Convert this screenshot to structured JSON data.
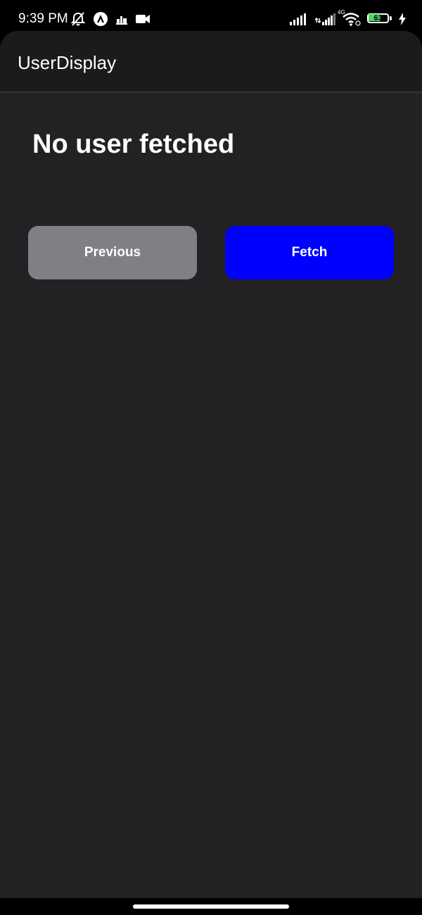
{
  "status_bar": {
    "time": "9:39 PM",
    "left_icons": [
      "bell-muted-icon",
      "app-logo-icon",
      "notification-icon",
      "video-camera-icon"
    ],
    "network_type": "4G",
    "battery_level": "63",
    "battery_fraction": 0.63,
    "battery_color": "#4cd964",
    "right_icons": [
      "cell-signal-icon",
      "cell-signal-4g-icon",
      "wifi-icon",
      "battery-icon",
      "charging-bolt-icon"
    ]
  },
  "app_bar": {
    "title": "UserDisplay"
  },
  "main": {
    "heading": "No user fetched",
    "buttons": {
      "previous_label": "Previous",
      "fetch_label": "Fetch"
    }
  },
  "colors": {
    "screen_background": "#232124",
    "header_background": "#1b1a1c",
    "previous_button": "#808084",
    "fetch_button": "#0000ff"
  }
}
